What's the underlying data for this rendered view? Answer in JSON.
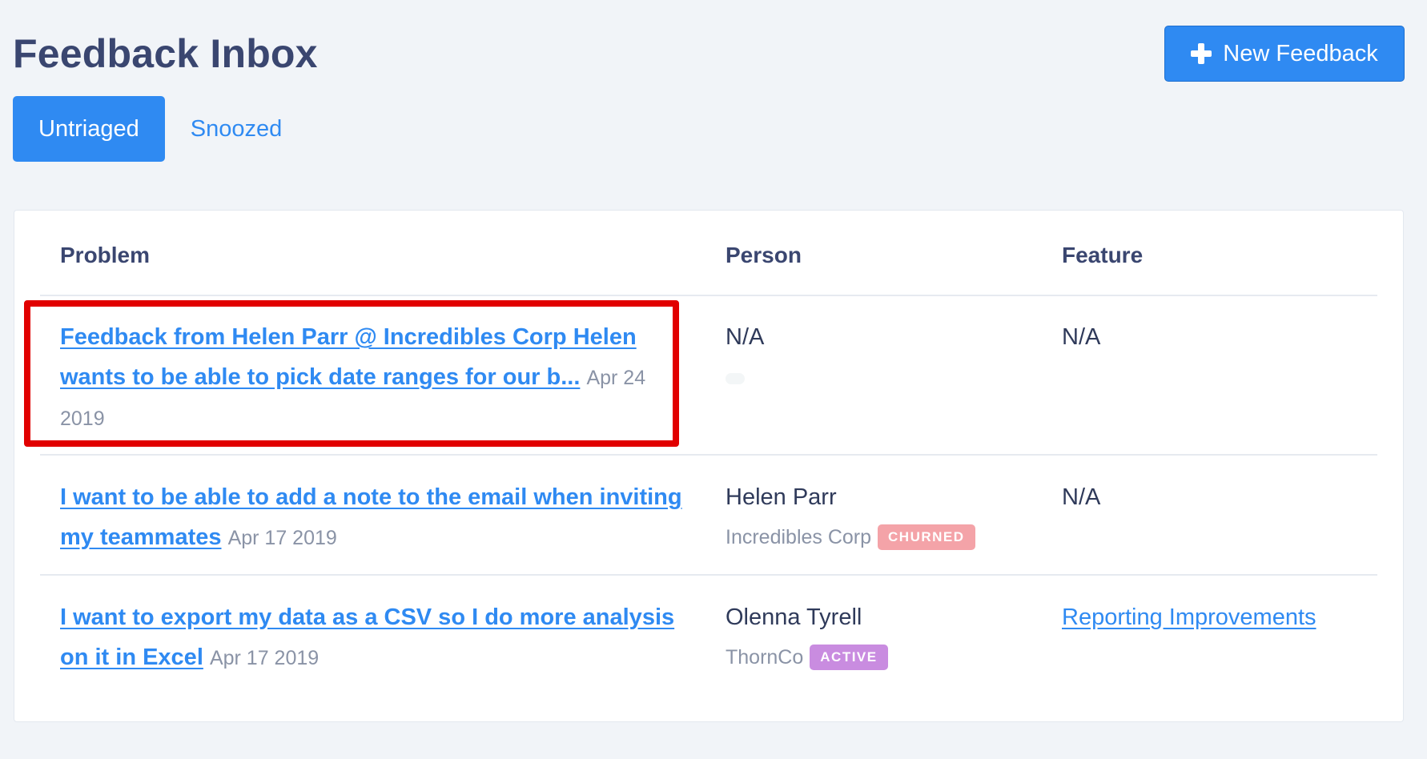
{
  "header": {
    "title": "Feedback Inbox",
    "new_button_label": "New Feedback"
  },
  "tabs": [
    {
      "label": "Untriaged",
      "active": true
    },
    {
      "label": "Snoozed",
      "active": false
    }
  ],
  "table": {
    "columns": [
      "Problem",
      "Person",
      "Feature"
    ],
    "rows": [
      {
        "problem_line1": "Feedback from Helen Parr @ Incredibles Corp Helen",
        "problem_line2": "wants to be able to pick date ranges for our b...",
        "date_part1": "Apr 24",
        "date_part2": "2019",
        "person": "N/A",
        "feature": "N/A"
      },
      {
        "problem_line1": "I want to be able to add a note to the email when inviting",
        "problem_line2": "my teammates",
        "date": "Apr 17 2019",
        "person": "Helen Parr",
        "company": "Incredibles Corp",
        "status": "CHURNED",
        "feature": "N/A"
      },
      {
        "problem_line1": "I want to export my data as a CSV so I do more analysis",
        "problem_line2": "on it in Excel",
        "date": "Apr 17 2019",
        "person": "Olenna Tyrell",
        "company": "ThornCo",
        "status": "ACTIVE",
        "feature": "Reporting Improvements"
      }
    ]
  },
  "colors": {
    "accent": "#2f8af2",
    "background": "#f1f4f8",
    "churned_badge": "#f4a3a8",
    "active_badge": "#c98ce0",
    "highlight": "#e10000"
  },
  "icons": {
    "new_button_icon": "plus-icon"
  }
}
